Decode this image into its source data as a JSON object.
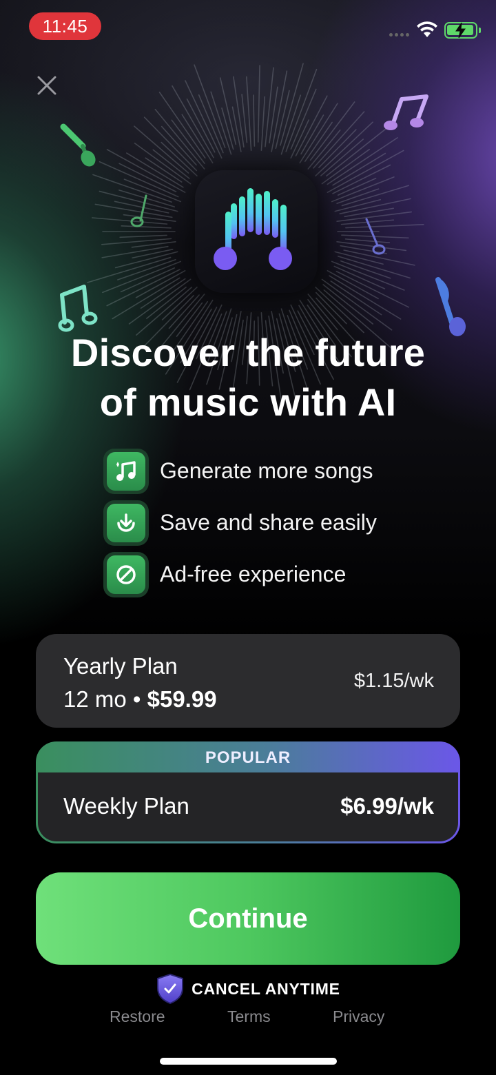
{
  "status_bar": {
    "time": "11:45",
    "time_pill_color": "#e0353b",
    "battery_color": "#5fd86a",
    "icons": [
      "signal-dots-icon",
      "wifi-icon",
      "battery-charging-icon"
    ]
  },
  "close_icon": "close-icon",
  "app_icon": "music-waveform-app-icon",
  "decor_icons": [
    "music-note-icon",
    "double-music-note-icon"
  ],
  "headline": {
    "line1": "Discover the future",
    "line2": "of music with AI"
  },
  "features": [
    {
      "icon": "music-notes-icon",
      "label": "Generate more songs"
    },
    {
      "icon": "download-icon",
      "label": "Save and share easily"
    },
    {
      "icon": "no-ads-icon",
      "label": "Ad-free experience"
    }
  ],
  "plans": {
    "yearly": {
      "name": "Yearly Plan",
      "duration": "12 mo",
      "separator": "•",
      "total": "$59.99",
      "per_week": "$1.15/wk"
    },
    "weekly": {
      "badge": "POPULAR",
      "name": "Weekly Plan",
      "price": "$6.99/wk",
      "selected": true
    }
  },
  "cta": {
    "label": "Continue",
    "color_start": "#6fe07a",
    "color_end": "#1f9a3e"
  },
  "cancel_anytime": {
    "icon": "shield-check-icon",
    "label": "CANCEL ANYTIME"
  },
  "footer_links": {
    "restore": "Restore",
    "terms": "Terms",
    "privacy": "Privacy"
  }
}
